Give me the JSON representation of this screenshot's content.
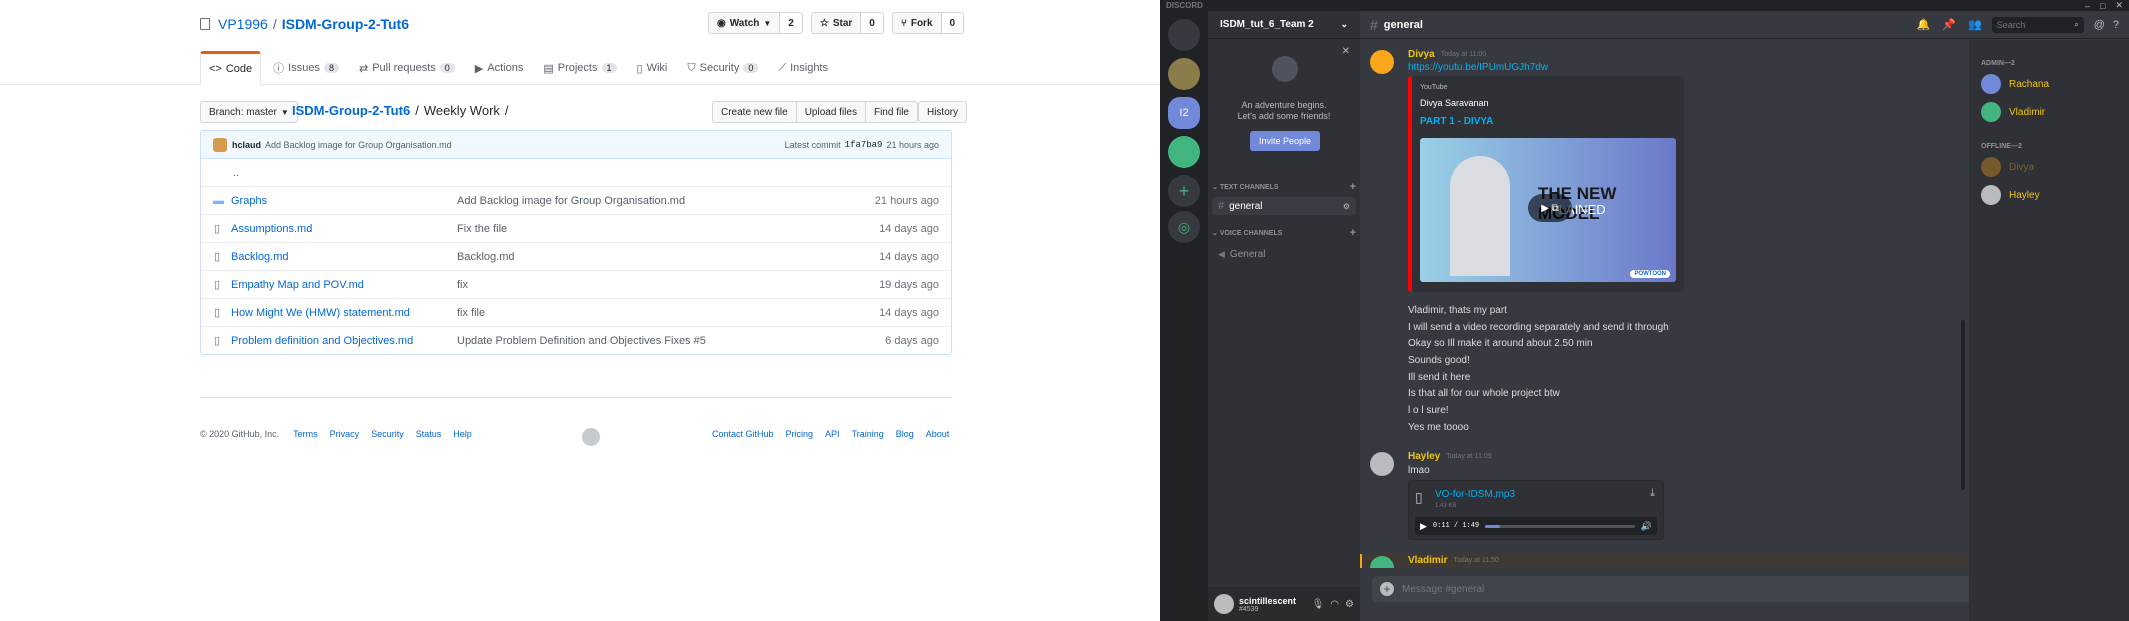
{
  "github": {
    "owner": "VP1996",
    "sep": "/",
    "repo": "ISDM-Group-2-Tut6",
    "watch_label": "Watch",
    "watch_count": "2",
    "star_label": "Star",
    "star_count": "0",
    "fork_label": "Fork",
    "fork_count": "0",
    "tabs": [
      {
        "label": "Code",
        "count": ""
      },
      {
        "label": "Issues",
        "count": "8"
      },
      {
        "label": "Pull requests",
        "count": "0"
      },
      {
        "label": "Actions",
        "count": ""
      },
      {
        "label": "Projects",
        "count": "1"
      },
      {
        "label": "Wiki",
        "count": ""
      },
      {
        "label": "Security",
        "count": "0"
      },
      {
        "label": "Insights",
        "count": ""
      }
    ],
    "branch_label": "Branch: master",
    "path_repo": "ISDM-Group-2-Tut6",
    "path_dir": "Weekly Work",
    "path_sep": "/",
    "buttons": {
      "create": "Create new file",
      "upload": "Upload files",
      "find": "Find file",
      "history": "History"
    },
    "commit": {
      "user": "hclaud",
      "message": "Add Backlog image for Group Organisation.md",
      "latest": "Latest commit",
      "hash": "1fa7ba9",
      "time": "21 hours ago"
    },
    "parent": "..",
    "files": [
      {
        "name": "Graphs",
        "type": "folder",
        "message": "Add Backlog image for Group Organisation.md",
        "age": "21 hours ago"
      },
      {
        "name": "Assumptions.md",
        "type": "file",
        "message": "Fix the file",
        "age": "14 days ago"
      },
      {
        "name": "Backlog.md",
        "type": "file",
        "message": "Backlog.md",
        "age": "14 days ago"
      },
      {
        "name": "Empathy Map and POV.md",
        "type": "file",
        "message": "fix",
        "age": "19 days ago"
      },
      {
        "name": "How Might We (HMW) statement.md",
        "type": "file",
        "message": "fix file",
        "age": "14 days ago"
      },
      {
        "name": "Problem definition and Objectives.md",
        "type": "file",
        "message": "Update Problem Definition and Objectives Fixes #5",
        "age": "6 days ago"
      }
    ],
    "footer_left": [
      "© 2020 GitHub, Inc.",
      "Terms",
      "Privacy",
      "Security",
      "Status",
      "Help"
    ],
    "footer_right": [
      "Contact GitHub",
      "Pricing",
      "API",
      "Training",
      "Blog",
      "About"
    ]
  },
  "discord": {
    "brand": "DISCORD",
    "server_name": "ISDM_tut_6_Team 2",
    "server_badge": "I2",
    "channel": "general",
    "search_placeholder": "Search",
    "invite": {
      "line1": "An adventure begins.",
      "line2": "Let's add some friends!",
      "button": "Invite People"
    },
    "text_channels_label": "TEXT CHANNELS",
    "voice_channels_label": "VOICE CHANNELS",
    "text_channel": "general",
    "voice_channel": "General",
    "user": {
      "name": "scintillescent",
      "tag": "#4539"
    },
    "messages": {
      "m1": {
        "author": "Divya",
        "time": "Today at 11:00",
        "link": "https://youtu.be/IPUmUGJh7dw",
        "embed_provider": "YouTube",
        "embed_author": "Divya Saravanan",
        "embed_title": "PART 1 - DIVYA",
        "thumb_text1": "THE NEW MODEL",
        "thumb_text2": "PLAINED",
        "thumb_brand": "POWTOON"
      },
      "lines": [
        "Vladimir, thats my part",
        "I will send a video recording separately and send it through",
        "Okay so Ill make it around about 2.50 min",
        "Sounds good!",
        "Ill send it here",
        "Is that all for our whole project btw",
        "l o l sure!",
        "Yes me toooo"
      ],
      "m2": {
        "author": "Hayley",
        "time": "Today at 11:09",
        "text": "lmao",
        "file": "VO-for-IDSM.mp3",
        "size": "1.43 KB",
        "player_time": "0:11 / 1:49"
      },
      "m3": {
        "author": "Vladimir",
        "time": "Today at 11:50"
      }
    },
    "composer_placeholder": "Message #general",
    "members": {
      "online_header": "ADMIN—2",
      "offline_header": "OFFLINE—2",
      "online": [
        "Rachana",
        "Vladimir"
      ],
      "offline": [
        "Divya",
        "Hayley"
      ]
    },
    "colors": {
      "accent": "#7289da",
      "link": "#00b0f4",
      "author_yellow": "#f1c40f",
      "author_green": "#43b581"
    }
  }
}
